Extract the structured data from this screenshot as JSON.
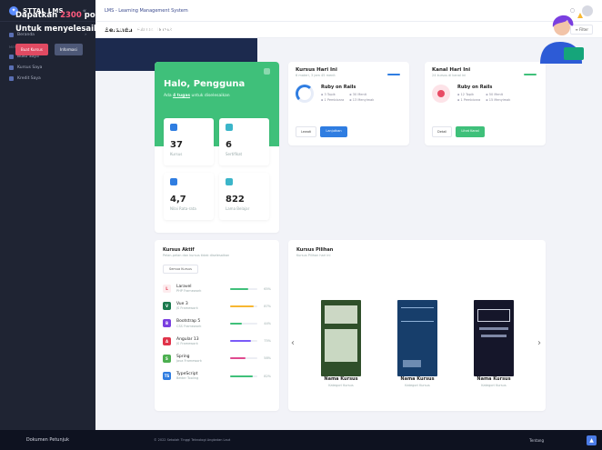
{
  "sidebar": {
    "brand": "STTAL LMS",
    "toggle": "«",
    "top_item": {
      "label": "Beranda",
      "arrow": "›"
    },
    "group_label": "MENU",
    "items": [
      {
        "label": "Buku Saya"
      },
      {
        "label": "Kursus Saya"
      },
      {
        "label": "Kredit Saya"
      }
    ],
    "footer": "Dokumen Petunjuk"
  },
  "topbar": {
    "title": "LMS - Learning Management System"
  },
  "subbar": {
    "title": "Beranda",
    "crumb1": "Halaman",
    "crumb2": "Beranda",
    "filter": "≡ Filter"
  },
  "hello": {
    "title": "Halo, Pengguna",
    "subtitle_pre": "Ada",
    "subtitle_bold": "4 tugas",
    "subtitle_post": "untuk diselesaikan",
    "stats": [
      {
        "value": "37",
        "label": "Kursus",
        "color": "#2f7de1"
      },
      {
        "value": "6",
        "label": "Sertifikat",
        "color": "#3bb5c9"
      },
      {
        "value": "4,7",
        "label": "Nilai Rata-rata",
        "color": "#2f7de1"
      },
      {
        "value": "822",
        "label": "Lama Belajar",
        "color": "#3bb5c9"
      }
    ]
  },
  "kursus_hari_ini": {
    "title": "Kursus Hari Ini",
    "subtitle": "6 materi, 3 jam 45 menit",
    "course": "Ruby on Rails",
    "meta": [
      "3 Topik",
      "30 Menit",
      "1 Pembicara",
      "13 Menyimak"
    ],
    "btn_ghost": "Lewati",
    "btn_solid": "Lanjutkan",
    "accent": "#2f7de1"
  },
  "kanal_hari_ini": {
    "title": "Kanal Hari Ini",
    "subtitle": "24 kursus di kanal ini",
    "course": "Ruby on Rails",
    "meta": [
      "12 Topik",
      "50 Menit",
      "1 Pembicara",
      "15 Menyimak"
    ],
    "btn_ghost": "Detail",
    "btn_solid": "Lihat Kanal",
    "accent": "#3fc07a"
  },
  "promo": {
    "l1_pre": "Dapatkan",
    "l1_hl": "2300",
    "l1_post": "poin.",
    "l2": "Untuk menyelesaikan kursus mandatory",
    "btn1": "Buat Kursus",
    "btn2": "Informasi"
  },
  "kursus_aktif": {
    "title": "Kursus Aktif",
    "subtitle": "Pelan-pelan dan kursus tidak diselesaikan",
    "btn": "Semua Kursus",
    "items": [
      {
        "name": "Laravel",
        "cat": "PHP Framework",
        "pct": "65%",
        "fill": 0.65,
        "color": "#3fc07a",
        "icon_color": "#f0f0f3",
        "icon_text": "L"
      },
      {
        "name": "Vue 3",
        "cat": "JS Framework",
        "pct": "87%",
        "fill": 0.87,
        "color": "#f7b731",
        "icon_color": "#1b7a4e",
        "icon_text": "V"
      },
      {
        "name": "Bootstrap 5",
        "cat": "CSS Framework",
        "pct": "44%",
        "fill": 0.44,
        "color": "#3fc07a",
        "icon_color": "#7a3fe0",
        "icon_text": "B"
      },
      {
        "name": "Angular 13",
        "cat": "JS Framework",
        "pct": "75%",
        "fill": 0.75,
        "color": "#7a5af8",
        "icon_color": "#e0344a",
        "icon_text": "A"
      },
      {
        "name": "Spring",
        "cat": "Java Framework",
        "pct": "58%",
        "fill": 0.58,
        "color": "#e04a8f",
        "icon_color": "#4caf50",
        "icon_text": "S"
      },
      {
        "name": "TypeScript",
        "cat": "Better Tooling",
        "pct": "82%",
        "fill": 0.82,
        "color": "#3fc07a",
        "icon_color": "#2f7de1",
        "icon_text": "TS"
      }
    ]
  },
  "kursus_pilihan": {
    "title": "Kursus Pilihan",
    "subtitle": "Kursus Pilihan hari ini",
    "prev": "‹",
    "next": "›",
    "books": [
      {
        "name": "Nama Kursus",
        "cat": "Kategori Kursus",
        "color": "#2f4f2a"
      },
      {
        "name": "Nama Kursus",
        "cat": "Kategori Kursus",
        "color": "#173e6b"
      },
      {
        "name": "Nama Kursus",
        "cat": "Kategori Kursus",
        "color": "#15162a"
      }
    ]
  },
  "footer": {
    "copyright": "© 2022 Sekolah Tinggi Teknologi Angkatan Laut",
    "link": "Tentang"
  }
}
